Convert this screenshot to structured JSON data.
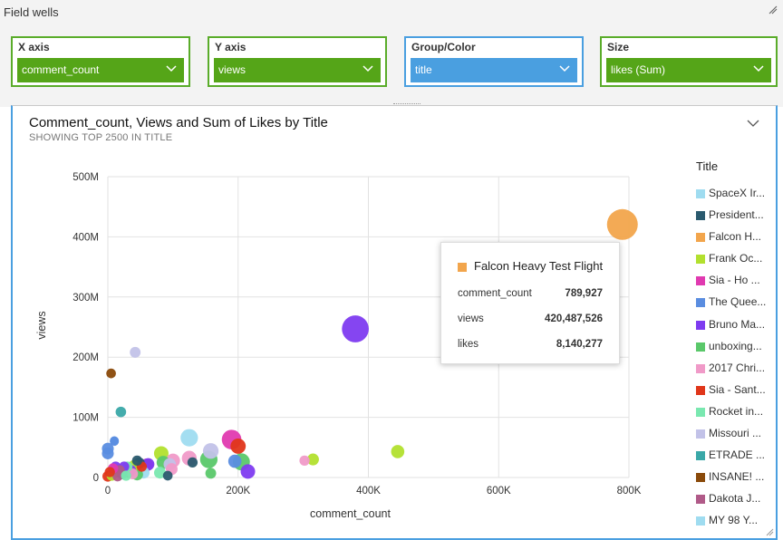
{
  "field_wells": {
    "title": "Field wells",
    "wells": [
      {
        "label": "X axis",
        "value": "comment_count"
      },
      {
        "label": "Y axis",
        "value": "views"
      },
      {
        "label": "Group/Color",
        "value": "title"
      },
      {
        "label": "Size",
        "value": "likes (Sum)"
      }
    ]
  },
  "visual": {
    "title": "Comment_count, Views and Sum of Likes by Title",
    "subtitle": "SHOWING TOP 2500 IN TITLE"
  },
  "legend": {
    "title": "Title",
    "items": [
      {
        "label": "SpaceX Ir...",
        "color": "#9fdcf0"
      },
      {
        "label": "President...",
        "color": "#2a5a6e"
      },
      {
        "label": "Falcon H...",
        "color": "#f2a54c"
      },
      {
        "label": "Frank Oc...",
        "color": "#b2e02e"
      },
      {
        "label": "Sia - Ho ...",
        "color": "#e03ab0"
      },
      {
        "label": "The Quee...",
        "color": "#5a8de0"
      },
      {
        "label": "Bruno Ma...",
        "color": "#7e3bf0"
      },
      {
        "label": "unboxing...",
        "color": "#5ac86a"
      },
      {
        "label": "2017 Chri...",
        "color": "#f09ac8"
      },
      {
        "label": "Sia - Sant...",
        "color": "#e0361a"
      },
      {
        "label": "Rocket in...",
        "color": "#7ae8b0"
      },
      {
        "label": "Missouri ...",
        "color": "#c2c2e8"
      },
      {
        "label": "ETRADE ...",
        "color": "#3aa8a8"
      },
      {
        "label": "INSANE! ...",
        "color": "#8a4a0a"
      },
      {
        "label": "Dakota J...",
        "color": "#b05a88"
      },
      {
        "label": "MY 98 Y...",
        "color": "#9fdcf0"
      }
    ]
  },
  "tooltip": {
    "title": "Falcon Heavy Test Flight",
    "rows": [
      {
        "label": "comment_count",
        "value": "789,927"
      },
      {
        "label": "views",
        "value": "420,487,526"
      },
      {
        "label": "likes",
        "value": "8,140,277"
      }
    ]
  },
  "chart_data": {
    "type": "scatter",
    "xlabel": "comment_count",
    "ylabel": "views",
    "xlim": [
      0,
      800000
    ],
    "ylim": [
      0,
      500000000
    ],
    "x_ticks": [
      "0",
      "200K",
      "400K",
      "600K",
      "800K"
    ],
    "y_ticks": [
      "0",
      "100M",
      "200M",
      "300M",
      "400M",
      "500M"
    ],
    "x_tick_values": [
      0,
      200000,
      400000,
      600000,
      800000
    ],
    "y_tick_values": [
      0,
      100000000,
      200000000,
      300000000,
      400000000,
      500000000
    ],
    "grid": true,
    "legend_position": "right",
    "size_field": "likes",
    "points": [
      {
        "name": "Falcon Heavy Test Flight",
        "x": 789927,
        "y": 420487526,
        "likes": 8140277,
        "color": "#f2a54c"
      },
      {
        "name": "Bruno Ma...",
        "x": 380000,
        "y": 247000000,
        "likes": 6200000,
        "color": "#7e3bf0"
      },
      {
        "name": "Frank Oc...",
        "x": 445000,
        "y": 43000000,
        "likes": 1500000,
        "color": "#b2e02e"
      },
      {
        "name": "Frank Oc...",
        "x": 315000,
        "y": 30000000,
        "likes": 1200000,
        "color": "#b2e02e"
      },
      {
        "name": "2017 Chri...",
        "x": 302000,
        "y": 28000000,
        "likes": 900000,
        "color": "#f09ac8"
      },
      {
        "name": "Missouri ...",
        "x": 42000,
        "y": 208000000,
        "likes": 1000000,
        "color": "#c2c2e8"
      },
      {
        "name": "INSANE! ...",
        "x": 5000,
        "y": 173000000,
        "likes": 800000,
        "color": "#8a4a0a"
      },
      {
        "name": "ETRADE ...",
        "x": 20000,
        "y": 109000000,
        "likes": 950000,
        "color": "#3aa8a8"
      },
      {
        "name": "Sia - Ho ...",
        "x": 190000,
        "y": 63000000,
        "likes": 3300000,
        "color": "#e03ab0"
      },
      {
        "name": "SpaceX Ir...",
        "x": 125000,
        "y": 66000000,
        "likes": 2600000,
        "color": "#9fdcf0"
      },
      {
        "name": "The Quee...",
        "x": 10000,
        "y": 61000000,
        "likes": 700000,
        "color": "#5a8de0"
      },
      {
        "name": "Sia - Sant...",
        "x": 200000,
        "y": 52000000,
        "likes": 2000000,
        "color": "#e0361a"
      },
      {
        "name": "Missouri ...",
        "x": 158000,
        "y": 44000000,
        "likes": 2100000,
        "color": "#c2c2e8"
      },
      {
        "name": "Frank Oc...",
        "x": 82000,
        "y": 40000000,
        "likes": 1800000,
        "color": "#b2e02e"
      },
      {
        "name": "The Quee...",
        "x": 0,
        "y": 48000000,
        "likes": 1200000,
        "color": "#5a8de0"
      },
      {
        "name": "The Quee...",
        "x": 0,
        "y": 40000000,
        "likes": 1200000,
        "color": "#5a8de0"
      },
      {
        "name": "unboxing...",
        "x": 155000,
        "y": 30000000,
        "likes": 2600000,
        "color": "#5ac86a"
      },
      {
        "name": "2017 Chri...",
        "x": 125000,
        "y": 32000000,
        "likes": 1900000,
        "color": "#f09ac8"
      },
      {
        "name": "President...",
        "x": 130000,
        "y": 25000000,
        "likes": 900000,
        "color": "#2a5a6e"
      },
      {
        "name": "unboxing...",
        "x": 205000,
        "y": 26000000,
        "likes": 2500000,
        "color": "#5ac86a"
      },
      {
        "name": "The Quee...",
        "x": 195000,
        "y": 27000000,
        "likes": 1500000,
        "color": "#5a8de0"
      },
      {
        "name": "Bruno Ma...",
        "x": 215000,
        "y": 10000000,
        "likes": 1800000,
        "color": "#7e3bf0"
      },
      {
        "name": "2017 Chri...",
        "x": 100000,
        "y": 28000000,
        "likes": 1700000,
        "color": "#f09ac8"
      },
      {
        "name": "Missouri ...",
        "x": 95000,
        "y": 22000000,
        "likes": 1300000,
        "color": "#c2c2e8"
      },
      {
        "name": "unboxing...",
        "x": 85000,
        "y": 25000000,
        "likes": 1500000,
        "color": "#5ac86a"
      },
      {
        "name": "unboxing...",
        "x": 158000,
        "y": 7000000,
        "likes": 1000000,
        "color": "#5ac86a"
      },
      {
        "name": "President...",
        "x": 92000,
        "y": 3000000,
        "likes": 800000,
        "color": "#2a5a6e"
      },
      {
        "name": "Rocket in...",
        "x": 80000,
        "y": 8000000,
        "likes": 1200000,
        "color": "#7ae8b0"
      },
      {
        "name": "2017 Chri...",
        "x": 98000,
        "y": 14000000,
        "likes": 1200000,
        "color": "#f09ac8"
      },
      {
        "name": "Bruno Ma...",
        "x": 62000,
        "y": 22000000,
        "likes": 1300000,
        "color": "#7e3bf0"
      },
      {
        "name": "Sia - Ho ...",
        "x": 60000,
        "y": 21000000,
        "likes": 1400000,
        "color": "#e03ab0"
      },
      {
        "name": "President...",
        "x": 48000,
        "y": 24000000,
        "likes": 1100000,
        "color": "#2a5a6e"
      },
      {
        "name": "Sia - Sant...",
        "x": 52000,
        "y": 18000000,
        "likes": 900000,
        "color": "#e0361a"
      },
      {
        "name": "Frank Oc...",
        "x": 40000,
        "y": 20000000,
        "likes": 1000000,
        "color": "#b2e02e"
      },
      {
        "name": "Rocket in...",
        "x": 30000,
        "y": 18000000,
        "likes": 900000,
        "color": "#7ae8b0"
      },
      {
        "name": "Bruno Ma...",
        "x": 25000,
        "y": 18000000,
        "likes": 900000,
        "color": "#7e3bf0"
      },
      {
        "name": "SpaceX Ir...",
        "x": 55000,
        "y": 8000000,
        "likes": 1200000,
        "color": "#9fdcf0"
      },
      {
        "name": "unboxing...",
        "x": 45000,
        "y": 5000000,
        "likes": 1200000,
        "color": "#5ac86a"
      },
      {
        "name": "INSANE! ...",
        "x": 32000,
        "y": 9000000,
        "likes": 1100000,
        "color": "#8a4a0a"
      },
      {
        "name": "Sia - Ho ...",
        "x": 25000,
        "y": 10000000,
        "likes": 1100000,
        "color": "#e03ab0"
      },
      {
        "name": "Bruno Ma...",
        "x": 12000,
        "y": 18000000,
        "likes": 900000,
        "color": "#7e3bf0"
      },
      {
        "name": "Sia - Sant...",
        "x": 10000,
        "y": 8000000,
        "likes": 1000000,
        "color": "#e0361a"
      },
      {
        "name": "Dakota J...",
        "x": 18000,
        "y": 12000000,
        "likes": 900000,
        "color": "#b05a88"
      },
      {
        "name": "ETRADE ...",
        "x": 22000,
        "y": 6000000,
        "likes": 1000000,
        "color": "#3aa8a8"
      },
      {
        "name": "Sia - Sant...",
        "x": 0,
        "y": 2000000,
        "likes": 1000000,
        "color": "#e0361a"
      },
      {
        "name": "Frank Oc...",
        "x": 6000,
        "y": 3000000,
        "likes": 900000,
        "color": "#b2e02e"
      },
      {
        "name": "Dakota J...",
        "x": 15000,
        "y": 2000000,
        "likes": 900000,
        "color": "#b05a88"
      },
      {
        "name": "Rocket in...",
        "x": 28000,
        "y": 3000000,
        "likes": 900000,
        "color": "#7ae8b0"
      },
      {
        "name": "Bruno Ma...",
        "x": 35000,
        "y": 12000000,
        "likes": 1000000,
        "color": "#7e3bf0"
      },
      {
        "name": "2017 Chri...",
        "x": 38000,
        "y": 6000000,
        "likes": 1000000,
        "color": "#f09ac8"
      },
      {
        "name": "President...",
        "x": 45000,
        "y": 28000000,
        "likes": 900000,
        "color": "#2a5a6e"
      },
      {
        "name": "Sia - Ho ...",
        "x": 8000,
        "y": 15000000,
        "likes": 900000,
        "color": "#e03ab0"
      },
      {
        "name": "Sia - Sant...",
        "x": 3000,
        "y": 9000000,
        "likes": 900000,
        "color": "#e0361a"
      },
      {
        "name": "The Quee...",
        "x": 10000,
        "y": 60000000,
        "likes": 700000,
        "color": "#5a8de0"
      }
    ]
  }
}
